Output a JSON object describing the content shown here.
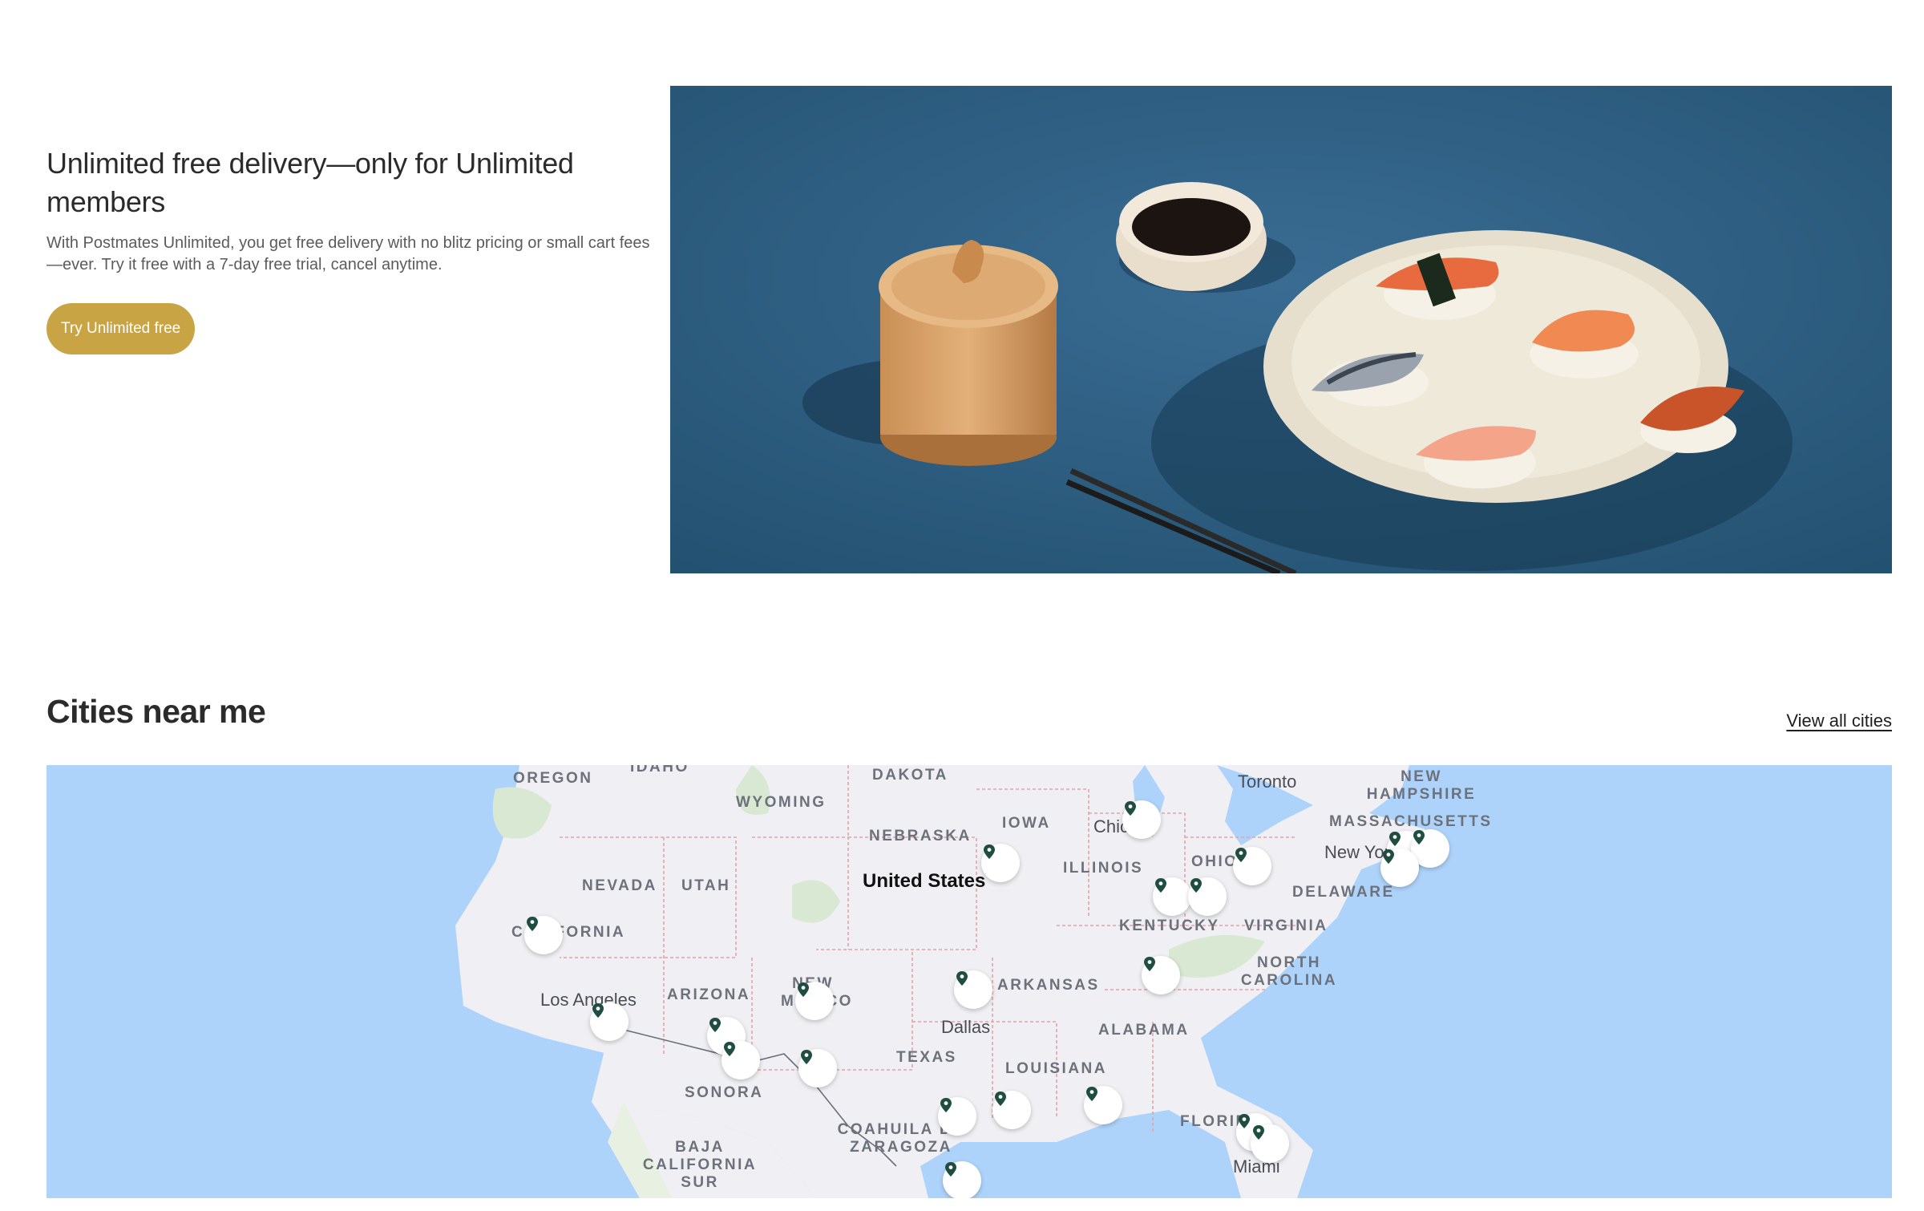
{
  "promo": {
    "title": "Unlimited free delivery—only for Unlimited members",
    "description": "With Postmates Unlimited, you get free delivery with no blitz pricing or small cart fees—ever. Try it free with a 7-day free trial, cancel anytime.",
    "cta_label": "Try Unlimited free"
  },
  "hero": {
    "photo_colors": {
      "background": "#2e5f86",
      "plate": "#ece6d6",
      "jar": "#c98f55"
    }
  },
  "cities": {
    "title": "Cities near me",
    "view_all_label": "View all cities"
  },
  "map": {
    "colors": {
      "water": "#aed3fb",
      "land": "#f0f0f4",
      "pin": "#1f4d40",
      "border": "#e6a3a3"
    },
    "state_labels": [
      "OREGON",
      "IDAHO",
      "DAKOTA",
      "WYOMING",
      "NEW HAMPSHIRE",
      "MASSACHUSETTS",
      "IOWA",
      "NEBRASKA",
      "NEVADA",
      "UTAH",
      "ILLINOIS",
      "OHIO",
      "DELAWARE",
      "KENTUCKY",
      "VIRGINIA",
      "CALIFORNIA",
      "ARIZONA",
      "NEW MEXICO",
      "ARKANSAS",
      "NORTH CAROLINA",
      "ALABAMA",
      "TEXAS",
      "LOUISIANA",
      "SONORA",
      "FLORIDA",
      "COAHUILA DE ZARAGOZA",
      "BAJA CALIFORNIA SUR"
    ],
    "city_labels": [
      "Toronto",
      "Chicago",
      "New York",
      "Los Angeles",
      "Dallas",
      "Miami"
    ],
    "country_label": "United States",
    "pin_count": 23
  }
}
